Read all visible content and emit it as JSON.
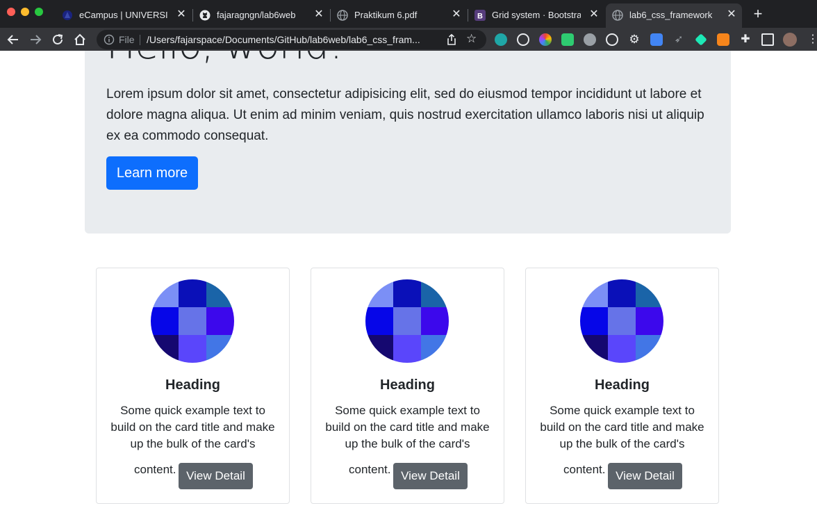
{
  "browser": {
    "tabs": [
      {
        "title": "eCampus | UNIVERSITA",
        "active": false
      },
      {
        "title": "fajaragngn/lab6web",
        "active": false
      },
      {
        "title": "Praktikum 6.pdf",
        "active": false
      },
      {
        "title": "Grid system · Bootstrap",
        "active": false
      },
      {
        "title": "lab6_css_framework",
        "active": true
      }
    ],
    "new_tab_label": "+",
    "address": {
      "scheme_label": "File",
      "url": "/Users/fajarspace/Documents/GitHub/lab6web/lab6_css_fram..."
    }
  },
  "page": {
    "jumbotron": {
      "title": "Hello, world!",
      "text": "Lorem ipsum dolor sit amet, consectetur adipisicing elit, sed do eiusmod tempor incididunt ut labore et dolore magna aliqua. Ut enim ad minim veniam, quis nostrud exercitation ullamco laboris nisi ut aliquip ex ea commodo consequat.",
      "button_label": "Learn more"
    },
    "cards": [
      {
        "heading": "Heading",
        "text": "Some quick example text to build on the card title and make up the bulk of the card's",
        "text_end": "content.",
        "button_label": "View Detail"
      },
      {
        "heading": "Heading",
        "text": "Some quick example text to build on the card title and make up the bulk of the card's",
        "text_end": "content.",
        "button_label": "View Detail"
      },
      {
        "heading": "Heading",
        "text": "Some quick example text to build on the card title and make up the bulk of the card's",
        "text_end": "content.",
        "button_label": "View Detail"
      }
    ],
    "colors": {
      "primary": "#0d6efd",
      "secondary": "#5c636a",
      "jumbotron_bg": "#e9ecef"
    }
  }
}
